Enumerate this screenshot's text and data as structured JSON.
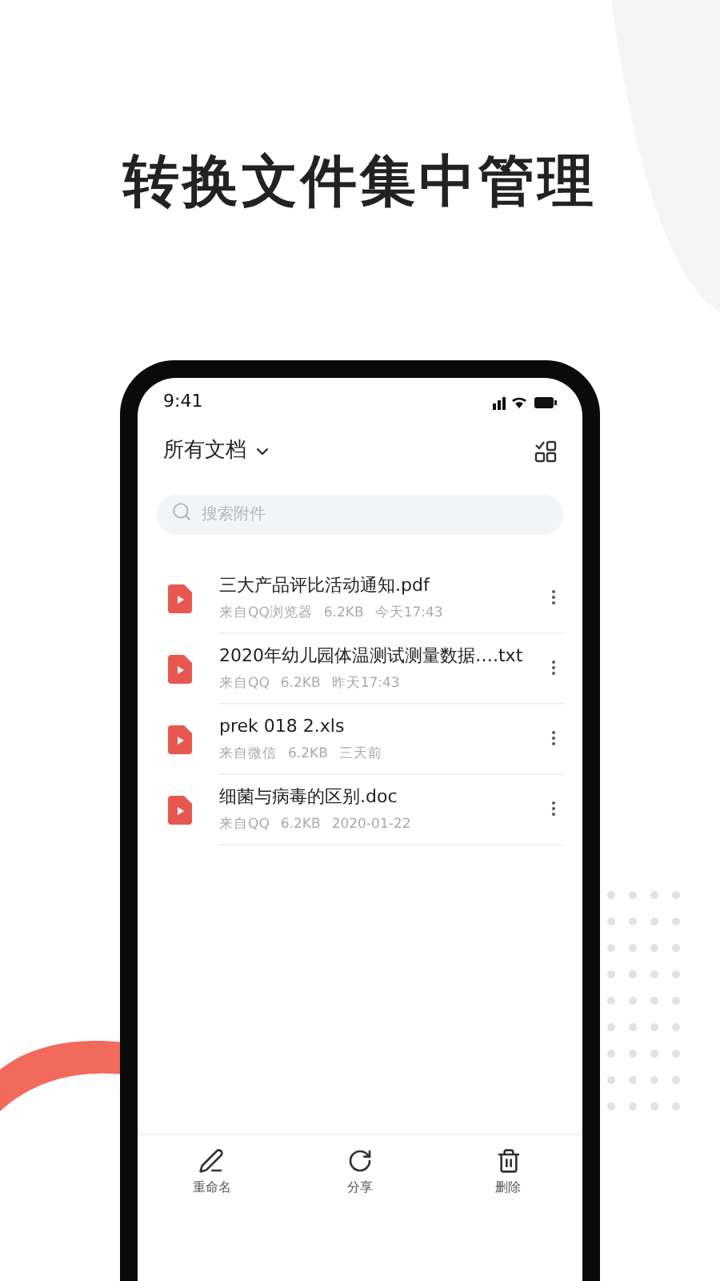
{
  "headline": "转换文件集中管理",
  "status_bar": {
    "time": "9:41"
  },
  "header": {
    "title": "所有文档"
  },
  "search": {
    "placeholder": "搜索附件"
  },
  "files": [
    {
      "name": "三大产品评比活动通知.pdf",
      "source": "来自QQ浏览器",
      "size": "6.2KB",
      "time": "今天17:43"
    },
    {
      "name": "2020年幼儿园体温测试测量数据….txt",
      "source": "来自QQ",
      "size": "6.2KB",
      "time": "昨天17:43"
    },
    {
      "name": "prek 018 2.xls",
      "source": "来自微信",
      "size": "6.2KB",
      "time": "三天前"
    },
    {
      "name": "细菌与病毒的区别.doc",
      "source": "来自QQ",
      "size": "6.2KB",
      "time": "2020-01-22"
    }
  ],
  "actions": [
    {
      "kind": "rename",
      "label": "重命名"
    },
    {
      "kind": "share",
      "label": "分享"
    },
    {
      "kind": "delete",
      "label": "删除"
    }
  ]
}
